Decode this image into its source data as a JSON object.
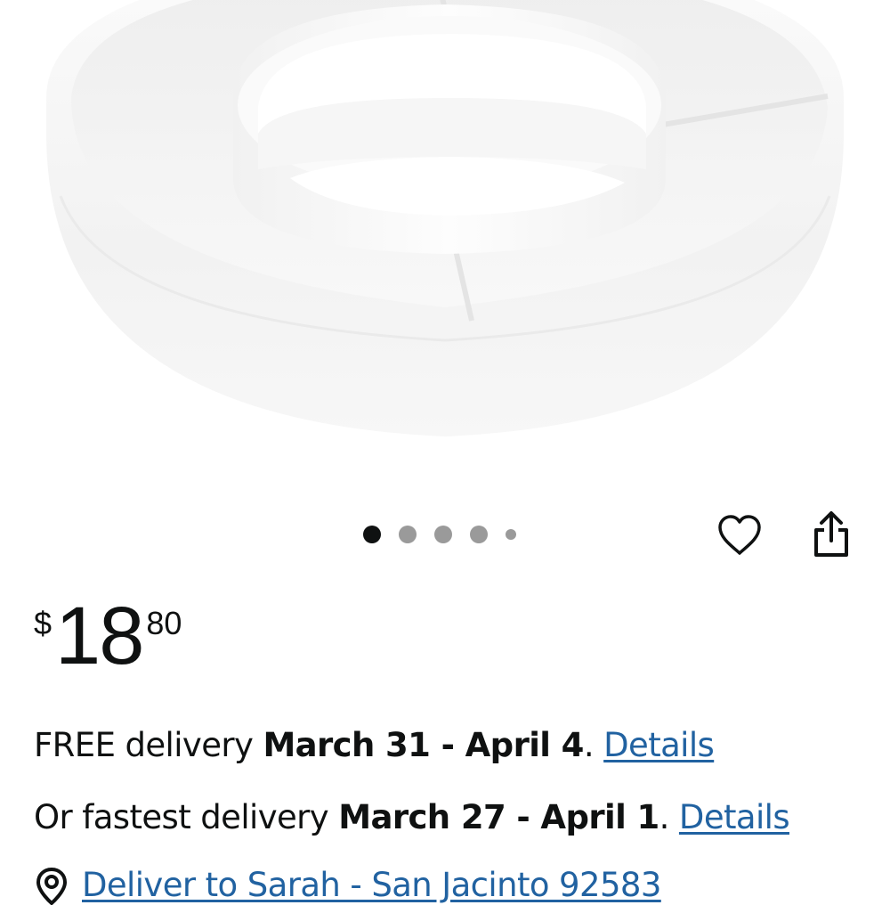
{
  "product": {
    "image_icon": "divided-serving-bowl-image",
    "carousel": {
      "total_dots": 5,
      "active_index": 0
    },
    "wishlist_icon": "heart-icon",
    "share_icon": "share-icon"
  },
  "price": {
    "symbol": "$",
    "whole": "18",
    "fraction": "80"
  },
  "delivery": {
    "free": {
      "prefix": "FREE delivery ",
      "dates": "March 31 - April 4",
      "suffix": ". ",
      "link": "Details"
    },
    "fastest": {
      "prefix": "Or fastest delivery ",
      "dates": "March 27 - April 1",
      "suffix": ". ",
      "link": "Details"
    }
  },
  "location": {
    "icon": "location-pin-icon",
    "text": "Deliver to Sarah - San Jacinto 92583"
  },
  "colors": {
    "text": "#0f1111",
    "link": "#2162a1",
    "dot_active": "#0f1111",
    "dot_inactive": "#9a9a9a"
  }
}
